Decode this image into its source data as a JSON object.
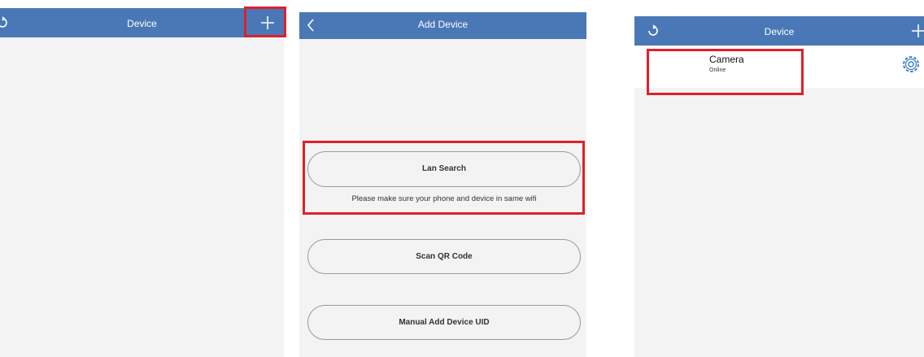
{
  "panel_device_empty": {
    "header": {
      "title": "Device",
      "refresh_icon": "refresh-icon",
      "add_icon": "plus-icon"
    }
  },
  "panel_add_device": {
    "header": {
      "title": "Add Device",
      "back_icon": "chevron-left-icon"
    },
    "options": {
      "lan_search": "Lan Search",
      "lan_hint": "Please make sure your phone and device in same wifi",
      "scan_qr": "Scan QR Code",
      "manual_uid": "Manual Add Device UID"
    }
  },
  "panel_device_list": {
    "header": {
      "title": "Device",
      "refresh_icon": "refresh-icon",
      "add_icon": "plus-icon"
    },
    "devices": [
      {
        "name": "Camera",
        "status": "Online",
        "settings_icon": "gear-icon"
      }
    ]
  },
  "colors": {
    "header": "#4a78b7",
    "highlight": "#e0202a",
    "panel_bg": "#f3f3f3",
    "icon_accent": "#3d7fcf"
  }
}
